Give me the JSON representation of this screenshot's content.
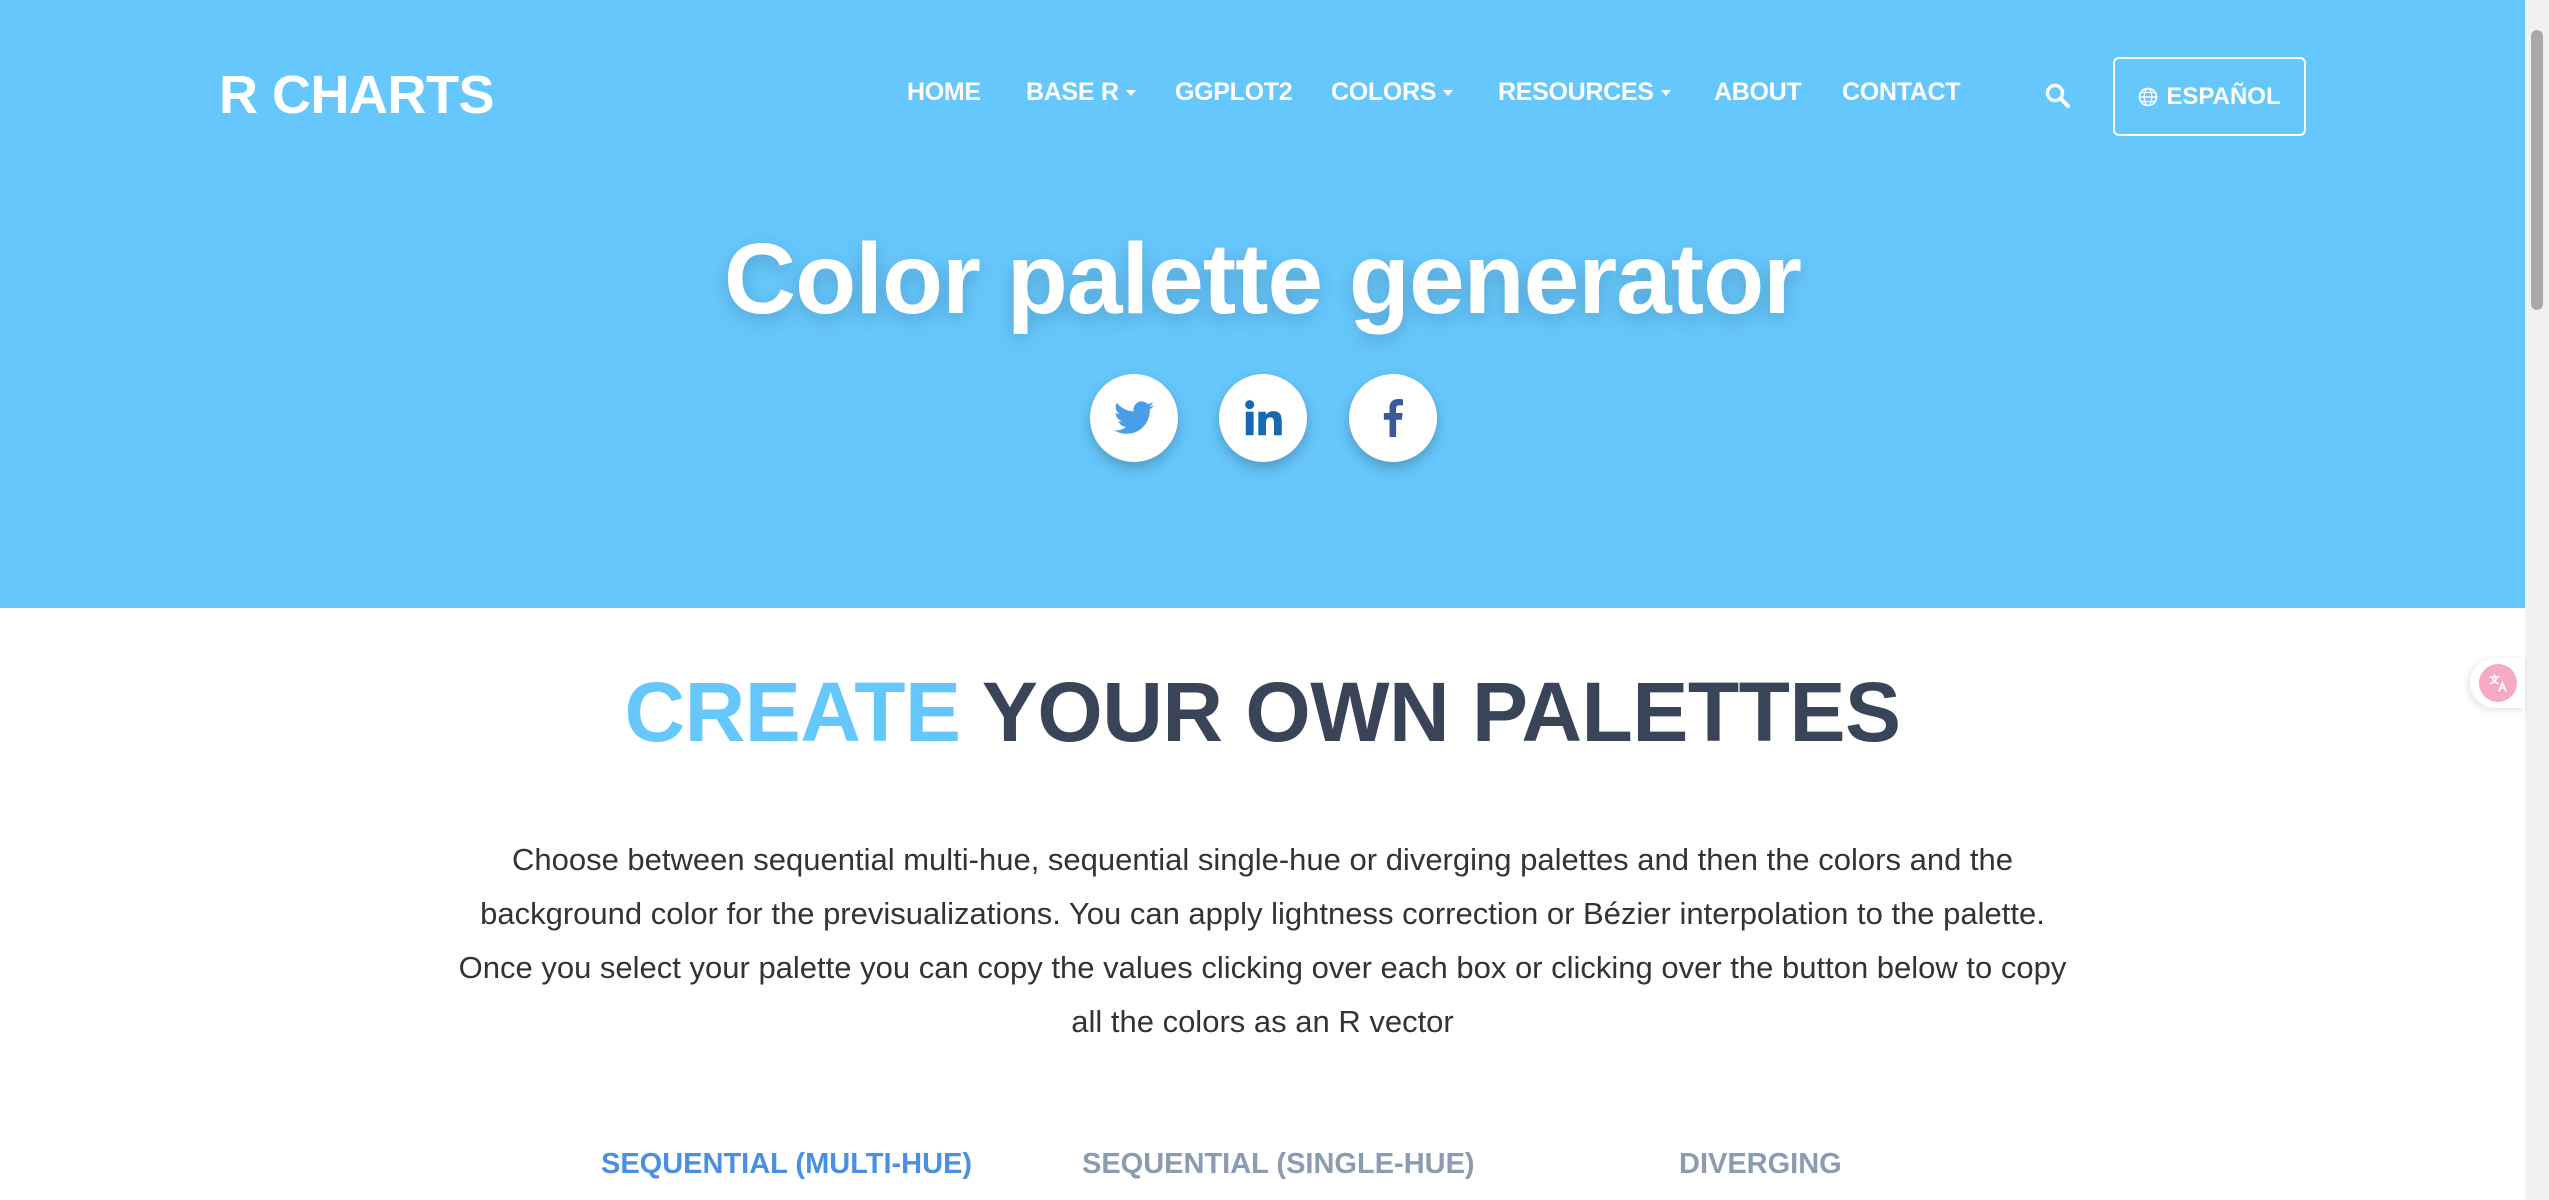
{
  "brand": {
    "logo": "R CHARTS"
  },
  "nav": {
    "home": "HOME",
    "base_r": "BASE R",
    "ggplot2": "GGPLOT2",
    "colors": "COLORS",
    "resources": "RESOURCES",
    "about": "ABOUT",
    "contact": "CONTACT"
  },
  "language_button": {
    "label": "ESPAÑOL",
    "icon": "globe-icon"
  },
  "search": {
    "icon": "search-icon"
  },
  "hero": {
    "title": "Color palette generator",
    "social": [
      {
        "icon": "twitter-icon",
        "color": "#4a9ee8"
      },
      {
        "icon": "linkedin-icon",
        "color": "#1769b3"
      },
      {
        "icon": "facebook-icon",
        "color": "#3b5998"
      }
    ]
  },
  "section": {
    "title_accent": "CREATE",
    "title_rest": "YOUR OWN PALETTES",
    "description": "Choose between sequential multi-hue, sequential single-hue or diverging palettes and then the colors and the background color for the previsualizations. You can apply lightness correction or Bézier interpolation to the palette. Once you select your palette you can copy the values clicking over each box or clicking over the button below to copy all the colors as an R vector"
  },
  "tabs": {
    "multi_hue": "SEQUENTIAL (MULTI-HUE)",
    "single_hue": "SEQUENTIAL (SINGLE-HUE)",
    "diverging": "DIVERGING",
    "active_color": "#4a90e2",
    "inactive_color": "#8a9bb3"
  },
  "colors": {
    "hero_bg": "#66c7fc",
    "accent": "#66c7fc",
    "heading": "#3a4459"
  }
}
